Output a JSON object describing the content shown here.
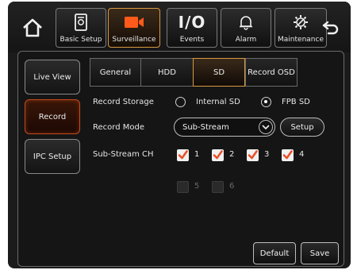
{
  "nav": {
    "home_icon": "home-icon",
    "back_icon": "back-arrow-icon",
    "tabs": [
      {
        "label": "Basic Setup",
        "icon": "document-icon"
      },
      {
        "label": "Surveillance",
        "icon": "camera-icon",
        "active": true
      },
      {
        "label": "Events",
        "icon_text": "I/O"
      },
      {
        "label": "Alarm",
        "icon": "bell-icon"
      },
      {
        "label": "Maintenance",
        "icon": "gear-wrench-icon"
      }
    ]
  },
  "sidebar": {
    "items": [
      {
        "label": "Live View"
      },
      {
        "label": "Record",
        "active": true
      },
      {
        "label": "IPC Setup"
      }
    ]
  },
  "subtabs": [
    {
      "label": "General"
    },
    {
      "label": "HDD"
    },
    {
      "label": "SD",
      "active": true
    },
    {
      "label": "Record OSD"
    }
  ],
  "form": {
    "record_storage": {
      "label": "Record Storage",
      "options": [
        {
          "label": "Internal SD",
          "selected": false
        },
        {
          "label": "FPB SD",
          "selected": true
        }
      ]
    },
    "record_mode": {
      "label": "Record Mode",
      "value": "Sub-Stream",
      "setup_label": "Setup"
    },
    "substream_ch": {
      "label": "Sub-Stream CH",
      "channels": [
        {
          "num": "1",
          "checked": true
        },
        {
          "num": "2",
          "checked": true
        },
        {
          "num": "3",
          "checked": true
        },
        {
          "num": "4",
          "checked": true
        },
        {
          "num": "5",
          "checked": false,
          "disabled": true
        },
        {
          "num": "6",
          "checked": false,
          "disabled": true
        }
      ]
    }
  },
  "footer": {
    "default_label": "Default",
    "save_label": "Save"
  },
  "colors": {
    "accent": "#d89a40",
    "active_side": "#c84a1a",
    "check": "#e8512a"
  }
}
